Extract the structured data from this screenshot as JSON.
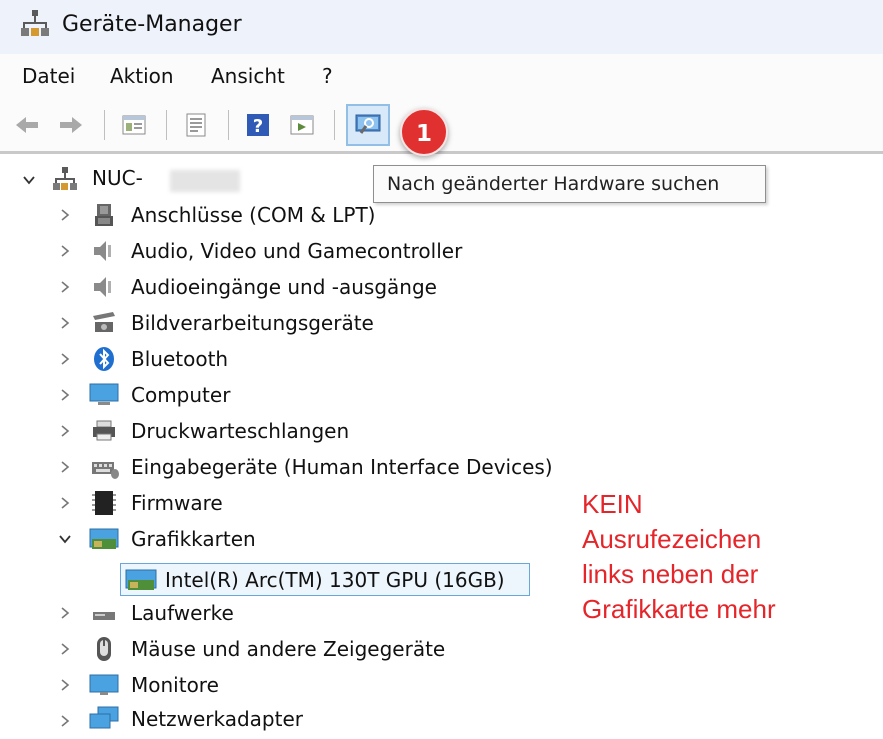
{
  "window": {
    "title": "Geräte-Manager"
  },
  "menu": [
    {
      "label": "Datei"
    },
    {
      "label": "Aktion"
    },
    {
      "label": "Ansicht"
    },
    {
      "label": "?"
    }
  ],
  "toolbar": {
    "buttons": [
      "back-arrow-icon",
      "forward-arrow-icon",
      "properties-icon",
      "update-driver-icon",
      "help-icon",
      "run-icon",
      "scan-hardware-icon"
    ],
    "badge": "1",
    "tooltip": "Nach geänderter Hardware suchen"
  },
  "tree": {
    "root": {
      "label": "NUC-",
      "expanded": true
    },
    "items": [
      {
        "label": "Anschlüsse (COM & LPT)",
        "icon": "port-icon",
        "expanded": false
      },
      {
        "label": "Audio, Video und Gamecontroller",
        "icon": "speaker-icon",
        "expanded": false
      },
      {
        "label": "Audioeingänge und -ausgänge",
        "icon": "speaker-icon",
        "expanded": false
      },
      {
        "label": "Bildverarbeitungsgeräte",
        "icon": "camera-icon",
        "expanded": false
      },
      {
        "label": "Bluetooth",
        "icon": "bluetooth-icon",
        "expanded": false
      },
      {
        "label": "Computer",
        "icon": "computer-icon",
        "expanded": false
      },
      {
        "label": "Druckwarteschlangen",
        "icon": "printer-icon",
        "expanded": false
      },
      {
        "label": "Eingabegeräte (Human Interface Devices)",
        "icon": "hid-icon",
        "expanded": false
      },
      {
        "label": "Firmware",
        "icon": "chip-icon",
        "expanded": false
      },
      {
        "label": "Grafikkarten",
        "icon": "display-adapter-icon",
        "expanded": true,
        "children": [
          {
            "label": "Intel(R) Arc(TM) 130T GPU (16GB)",
            "icon": "display-adapter-icon",
            "selected": true
          }
        ]
      },
      {
        "label": "Laufwerke",
        "icon": "drive-icon",
        "expanded": false
      },
      {
        "label": "Mäuse und andere Zeigegeräte",
        "icon": "mouse-icon",
        "expanded": false
      },
      {
        "label": "Monitore",
        "icon": "monitor-icon",
        "expanded": false
      },
      {
        "label": "Netzwerkadapter",
        "icon": "network-adapter-icon",
        "expanded": false
      }
    ]
  },
  "annotation": {
    "lines": [
      "KEIN",
      "Ausrufezeichen",
      "links neben der",
      "Grafikkarte mehr"
    ],
    "color": "#e4262b"
  },
  "colors": {
    "badge": "#e0302f",
    "selection_border": "#6aa6de",
    "selection_bg": "#eef6fd"
  }
}
